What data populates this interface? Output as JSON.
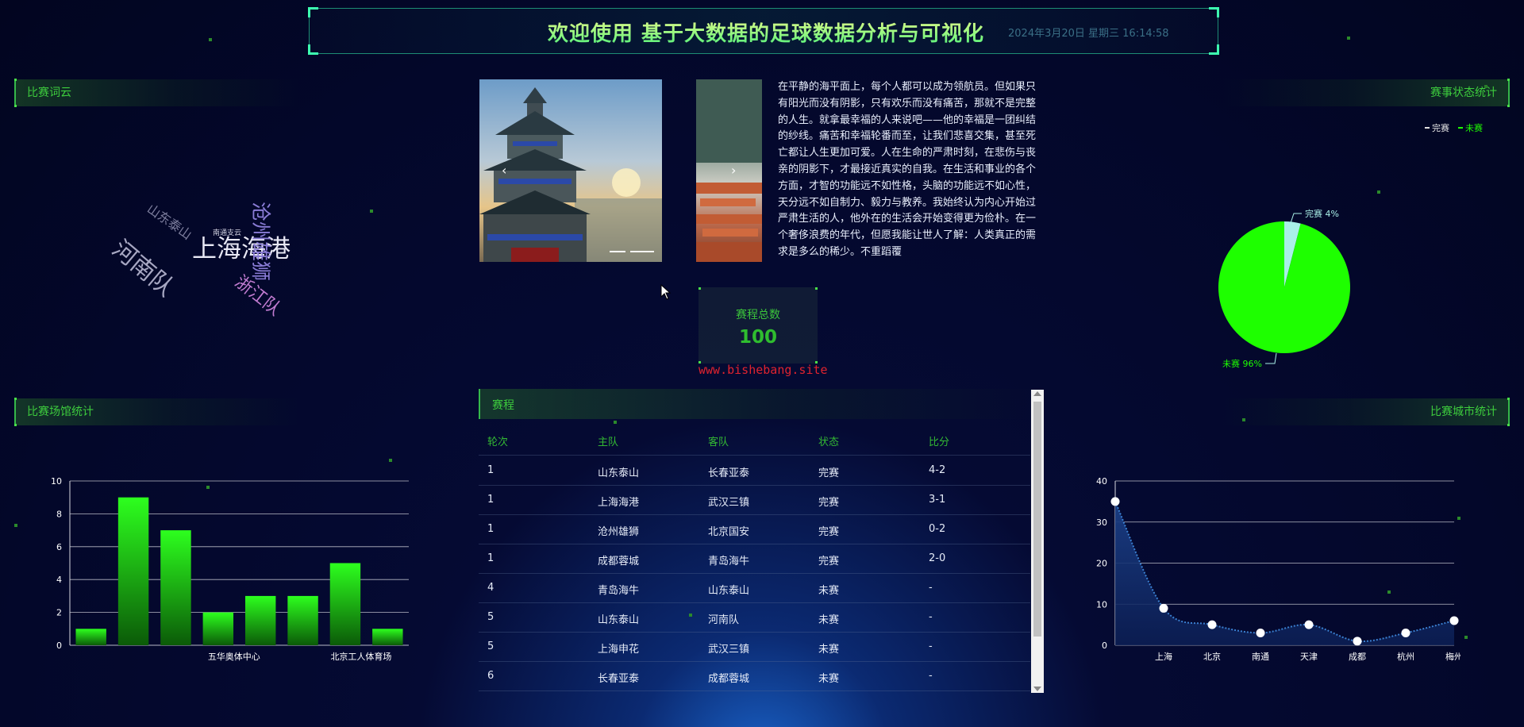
{
  "header": {
    "title": "欢迎使用 基于大数据的足球数据分析与可视化",
    "datetime": "2024年3月20日 星期三 16:14:58"
  },
  "panels": {
    "wordcloud_title": "比赛词云",
    "venue_title": "比赛场馆统计",
    "status_title": "赛事状态统计",
    "city_title": "比赛城市统计",
    "schedule_title": "赛程"
  },
  "wordcloud": {
    "words": [
      {
        "text": "上海海港",
        "color": "#e8e8f4"
      },
      {
        "text": "河南队",
        "color": "#a7a7c2"
      },
      {
        "text": "沧州雄狮",
        "color": "#8a7cd6"
      },
      {
        "text": "浙江队",
        "color": "#c07bd0"
      },
      {
        "text": "山东泰山",
        "color": "#7d7e9d"
      },
      {
        "text": "南通支云",
        "color": "#d0d0e0"
      }
    ]
  },
  "article": {
    "text": "在平静的海平面上，每个人都可以成为领航员。但如果只有阳光而没有阴影，只有欢乐而没有痛苦，那就不是完整的人生。就拿最幸福的人来说吧——他的幸福是一团纠结的纱线。痛苦和幸福轮番而至，让我们悲喜交集，甚至死亡都让人生更加可爱。人在生命的严肃时刻，在悲伤与丧亲的阴影下，才最接近真实的自我。在生活和事业的各个方面，才智的功能远不如性格，头脑的功能远不如心性，天分远不如自制力、毅力与教养。我始终认为内心开始过严肃生活的人，他外在的生活会开始变得更为俭朴。在一个奢侈浪费的年代，但愿我能让世人了解：人类真正的需求是多么的稀少。不重蹈覆"
  },
  "carousel": {
    "prev_icon": "‹",
    "next_icon": "›"
  },
  "total": {
    "label": "赛程总数",
    "value": "100"
  },
  "watermark": "www.bishebang.site",
  "schedule": {
    "columns": [
      "轮次",
      "主队",
      "客队",
      "状态",
      "比分"
    ],
    "rows": [
      [
        "1",
        "山东泰山",
        "长春亚泰",
        "完赛",
        "4-2"
      ],
      [
        "1",
        "上海海港",
        "武汉三镇",
        "完赛",
        "3-1"
      ],
      [
        "1",
        "沧州雄狮",
        "北京国安",
        "完赛",
        "0-2"
      ],
      [
        "1",
        "成都蓉城",
        "青岛海牛",
        "完赛",
        "2-0"
      ],
      [
        "4",
        "青岛海牛",
        "山东泰山",
        "未赛",
        "-"
      ],
      [
        "5",
        "山东泰山",
        "河南队",
        "未赛",
        "-"
      ],
      [
        "5",
        "上海申花",
        "武汉三镇",
        "未赛",
        "-"
      ],
      [
        "6",
        "长春亚泰",
        "成都蓉城",
        "未赛",
        "-"
      ]
    ]
  },
  "colors": {
    "accent_green": "#3dcc3d",
    "bar_top": "#2dff1e",
    "bar_bottom": "#0b5a08",
    "pie_unplayed": "#1eff00",
    "pie_finished": "#a9f0e8",
    "line": "#3a7fd0",
    "area": "#14306a"
  },
  "chart_data": [
    {
      "type": "bar",
      "title": "比赛场馆统计",
      "categories": [
        "",
        "",
        "",
        "五华奥体中心",
        "",
        "",
        "北京工人体育场",
        ""
      ],
      "values": [
        1,
        9,
        7,
        2,
        3,
        3,
        5,
        1
      ],
      "ylim": [
        0,
        10
      ],
      "yticks": [
        0,
        2,
        4,
        6,
        8,
        10
      ],
      "grid": true
    },
    {
      "type": "pie",
      "title": "赛事状态统计",
      "legend": [
        "完赛",
        "未赛"
      ],
      "legend_position": "top-right",
      "slices": [
        {
          "name": "完赛",
          "value": 4,
          "label": "完赛 4%"
        },
        {
          "name": "未赛",
          "value": 96,
          "label": "未赛 96%"
        }
      ]
    },
    {
      "type": "area",
      "title": "比赛城市统计",
      "categories": [
        "",
        "上海",
        "北京",
        "南通",
        "天津",
        "成都",
        "杭州",
        "梅州"
      ],
      "values": [
        35,
        9,
        5,
        3,
        5,
        1,
        3,
        6
      ],
      "ylim": [
        0,
        40
      ],
      "yticks": [
        0,
        10,
        20,
        30,
        40
      ],
      "grid": true
    }
  ]
}
